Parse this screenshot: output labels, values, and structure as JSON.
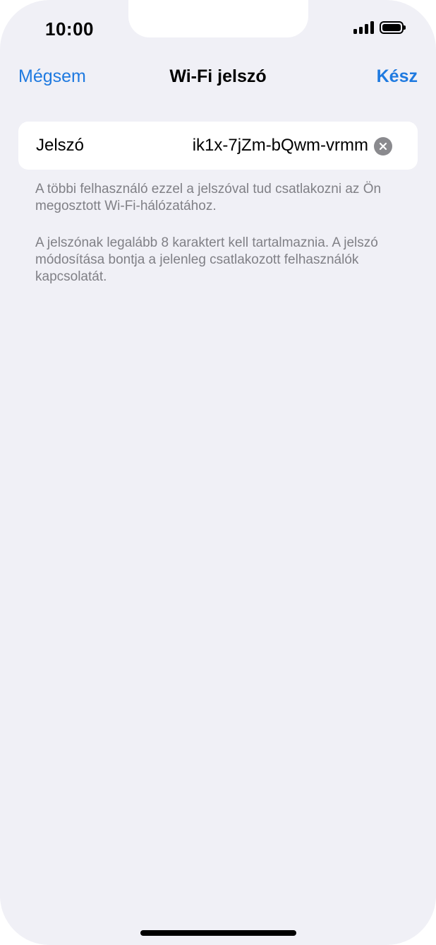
{
  "status_bar": {
    "time": "10:00"
  },
  "nav": {
    "cancel_label": "Mégsem",
    "title": "Wi-Fi jelszó",
    "done_label": "Kész"
  },
  "password_field": {
    "label": "Jelszó",
    "value": "ik1x-7jZm-bQwm-vrmm"
  },
  "footer": {
    "note1": "A többi felhasználó ezzel a jelszóval tud csatlakozni az Ön megosztott Wi-Fi-hálózatához.",
    "note2": "A jelszónak legalább 8 karaktert kell tartalmaznia. A jelszó módosítása bontja a jelenleg csatlakozott felhasználók kapcsolatát."
  },
  "colors": {
    "accent": "#1F7AE0",
    "background": "#F0F0F6",
    "secondary_text": "#808086"
  },
  "icons": {
    "signal": "cellular-signal-icon",
    "battery": "battery-icon",
    "clear": "clear-text-icon"
  }
}
